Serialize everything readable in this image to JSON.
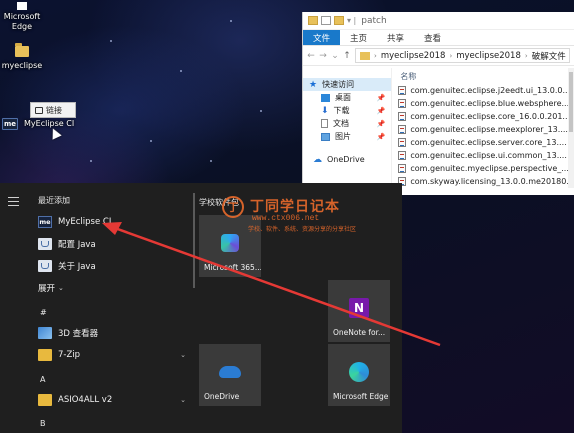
{
  "desktop": {
    "icons": [
      {
        "label": "Microsoft Edge"
      },
      {
        "label": "myeclipse"
      },
      {
        "label": "MyEclipse CI"
      }
    ],
    "tooltip": "链接"
  },
  "explorer": {
    "title": "patch",
    "ribbon_tabs": [
      "文件",
      "主页",
      "共享",
      "查看"
    ],
    "address": [
      "myeclipse2018",
      "myeclipse2018",
      "破解文件"
    ],
    "nav": {
      "quick_access": "快速访问",
      "items": [
        "桌面",
        "下载",
        "文档",
        "图片"
      ],
      "onedrive": "OneDrive"
    },
    "column_header": "名称",
    "files": [
      "com.genuitec.eclipse.j2eedt.ui_13.0.0...",
      "com.genuitec.eclipse.blue.websphere...",
      "com.genuitec.eclipse.core_16.0.0.201...",
      "com.genuitec.eclipse.meexplorer_13....",
      "com.genuitec.eclipse.server.core_13....",
      "com.genuitec.eclipse.ui.common_13....",
      "com.genuitec.myeclipse.perspective_...",
      "com.skyway.licensing_13.0.0.me20180..."
    ]
  },
  "start_menu": {
    "recent_header": "最近添加",
    "recent": [
      {
        "label": "MyEclipse CI",
        "icon": "myeclipse-icon"
      },
      {
        "label": "配置 Java",
        "icon": "java-icon"
      },
      {
        "label": "关于 Java",
        "icon": "java-icon"
      }
    ],
    "expand_label": "展开",
    "groups": [
      {
        "letter": "#",
        "items": [
          {
            "label": "3D 查看器",
            "icon": "cube-icon"
          },
          {
            "label": "7-Zip",
            "icon": "folder-icon"
          }
        ]
      },
      {
        "letter": "A",
        "items": [
          {
            "label": "ASIO4ALL v2",
            "icon": "folder-icon"
          }
        ]
      },
      {
        "letter": "B",
        "items": []
      }
    ],
    "tiles_header": "学校软件包",
    "tiles": [
      {
        "label": "Microsoft 365...",
        "icon": "microsoft-365-icon"
      },
      {
        "label": "OneNote for...",
        "icon": "onenote-icon"
      },
      {
        "label": "OneDrive",
        "icon": "onedrive-icon"
      },
      {
        "label": "Microsoft Edge",
        "icon": "edge-icon"
      }
    ]
  },
  "watermark": {
    "logo": "丁",
    "title": "丁同学日记本",
    "url": "www.ctx006.net",
    "sub": "学校、软件、系统、资源分享的分享社区"
  },
  "colors": {
    "accent": "#1979ca",
    "arrow": "#e53935",
    "watermark": "#e6692b"
  }
}
